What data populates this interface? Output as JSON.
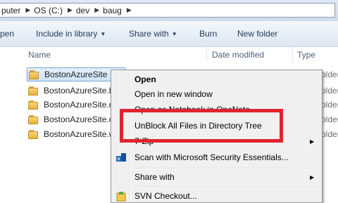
{
  "address_bar": {
    "crumbs": [
      "puter",
      "OS (C:)",
      "dev",
      "baug"
    ]
  },
  "command_bar": {
    "open": "pen",
    "include_in_library": "Include in library",
    "share_with": "Share with",
    "burn": "Burn",
    "new_folder": "New folder"
  },
  "columns": {
    "name": "Name",
    "date_modified": "Date modified",
    "type": "Type"
  },
  "files": [
    {
      "name": "BostonAzureSite",
      "type": "older"
    },
    {
      "name": "BostonAzureSite.b",
      "type": "older"
    },
    {
      "name": "BostonAzureSite.d",
      "type": "older"
    },
    {
      "name": "BostonAzureSite.o",
      "type": "older"
    },
    {
      "name": "BostonAzureSite.w",
      "type": "older"
    }
  ],
  "context_menu": {
    "open": "Open",
    "open_new_window": "Open in new window",
    "open_onenote": "Open as Notebook in OneNote",
    "unblock": "UnBlock All Files in Directory Tree",
    "zip": "7-Zip",
    "scan": "Scan with Microsoft Security Essentials...",
    "share_with": "Share with",
    "svn_checkout": "SVN Checkout..."
  },
  "colors": {
    "highlight_box": "#e0242e",
    "selection": "#cfe3fa"
  }
}
